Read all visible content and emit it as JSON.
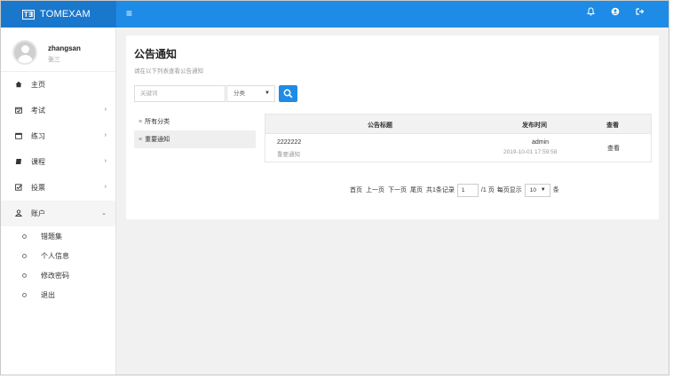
{
  "header": {
    "logo_mark": "T∃",
    "app_name": "TOMEXAM",
    "menu_icon": "hamburger-icon",
    "icons": [
      "bell-icon",
      "user-circle-icon",
      "logout-icon"
    ]
  },
  "user": {
    "name": "zhangsan",
    "display_name": "张三"
  },
  "sidebar": {
    "items": [
      {
        "label": "主页",
        "icon": "home-icon",
        "glyph": "❖",
        "arrow": ""
      },
      {
        "label": "考试",
        "icon": "calendar-check-icon",
        "glyph": "▣",
        "arrow": "›"
      },
      {
        "label": "练习",
        "icon": "calendar-icon",
        "glyph": "▤",
        "arrow": "›"
      },
      {
        "label": "课程",
        "icon": "book-icon",
        "glyph": "▰",
        "arrow": "›"
      },
      {
        "label": "投票",
        "icon": "checkbox-icon",
        "glyph": "☑",
        "arrow": "›"
      },
      {
        "label": "账户",
        "icon": "user-icon",
        "glyph": "♙",
        "arrow": "⌄"
      }
    ],
    "account_sub": [
      "错题集",
      "个人信息",
      "修改密码",
      "退出"
    ]
  },
  "main": {
    "title": "公告通知",
    "subtitle": "请在以下列表查看公告通知",
    "search": {
      "placeholder": "关键词",
      "category": "分类",
      "category_caret": "▼"
    },
    "categories": [
      "所有分类",
      "重要通知"
    ],
    "table": {
      "headers": {
        "title": "公告标题",
        "publish_time": "发布时间",
        "view": "查看"
      },
      "rows": [
        {
          "title": "2222222",
          "type": "重要通知",
          "publisher": "admin",
          "time": "2019-10-01 17:59:58",
          "view": "查看"
        }
      ]
    },
    "pagination": {
      "first": "首页",
      "prev": "上一页",
      "next": "下一页",
      "last": "尾页",
      "total": "共1条记录",
      "page": "1",
      "page_total": "/1 页",
      "per_page_label": "每页显示",
      "per_page": "10",
      "unit": "条"
    }
  },
  "colors": {
    "topbar": "#1e8ce6",
    "brand": "#1a78cc",
    "accent": "#1e8ce6"
  }
}
